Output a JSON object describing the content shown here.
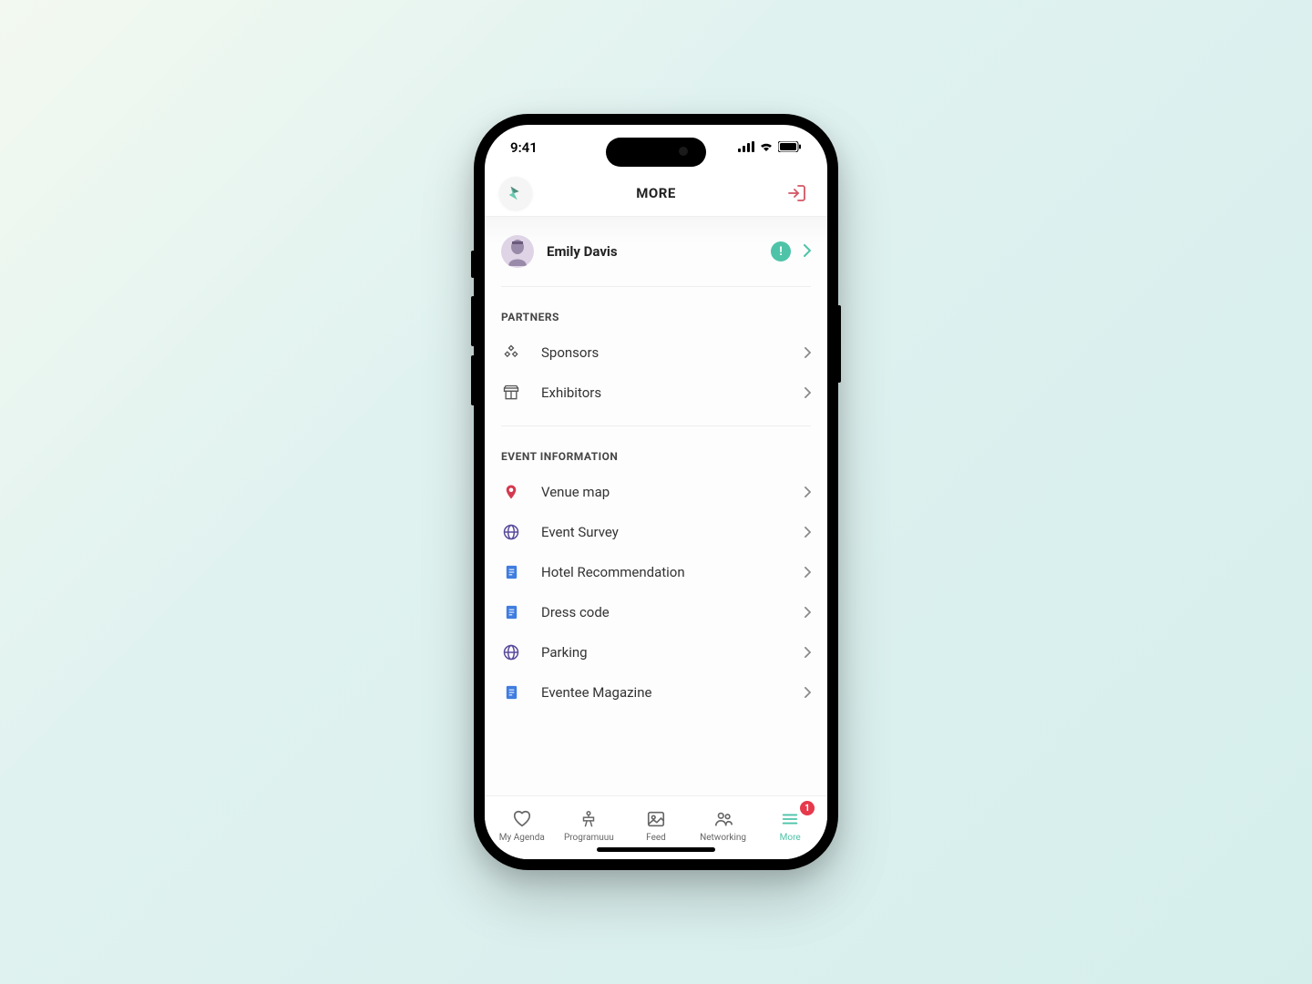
{
  "status": {
    "time": "9:41"
  },
  "header": {
    "title": "MORE"
  },
  "profile": {
    "name": "Emily Davis",
    "alert": "!"
  },
  "sections": {
    "partners": {
      "title": "PARTNERS",
      "items": [
        {
          "label": "Sponsors"
        },
        {
          "label": "Exhibitors"
        }
      ]
    },
    "eventInfo": {
      "title": "EVENT INFORMATION",
      "items": [
        {
          "label": "Venue map"
        },
        {
          "label": "Event Survey"
        },
        {
          "label": "Hotel Recommendation"
        },
        {
          "label": "Dress code"
        },
        {
          "label": "Parking"
        },
        {
          "label": "Eventee Magazine"
        }
      ]
    }
  },
  "tabs": [
    {
      "label": "My Agenda"
    },
    {
      "label": "Programuuu"
    },
    {
      "label": "Feed"
    },
    {
      "label": "Networking"
    },
    {
      "label": "More",
      "badge": "1"
    }
  ]
}
